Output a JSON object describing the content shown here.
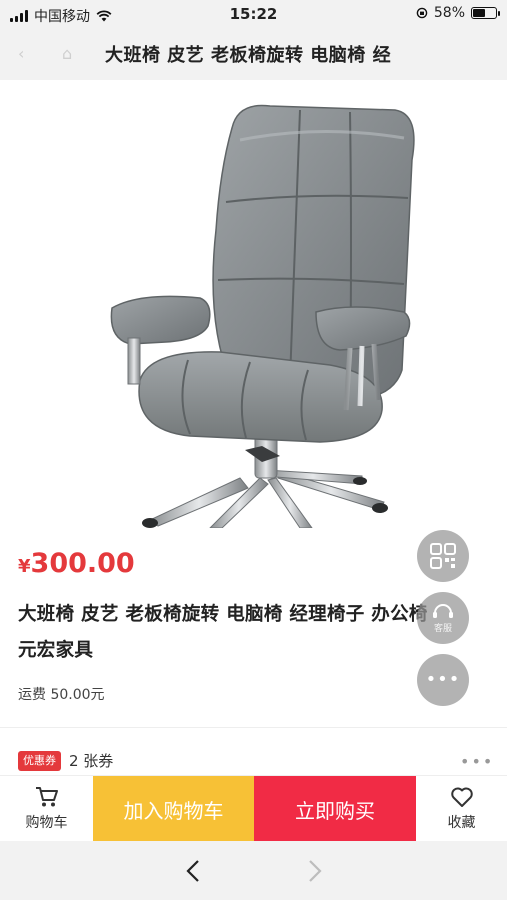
{
  "status_bar": {
    "carrier": "中国移动",
    "time": "15:22",
    "battery_percent": "58%",
    "battery_level": 0.58,
    "icons": [
      "signal-icon",
      "wifi-icon",
      "orientation-lock-icon",
      "battery-icon"
    ]
  },
  "header": {
    "title": "大班椅 皮艺 老板椅旋转 电脑椅 经"
  },
  "product": {
    "price_symbol": "¥",
    "price_value": "300.00",
    "name_line1": "大班椅 皮艺 老板椅旋转 电脑椅 经理椅子 办公椅",
    "name_line2": "元宏家具",
    "shipping": "运费 50.00元",
    "image_icon": "office-chair-image"
  },
  "side_buttons": {
    "qr_icon": "qr-code-icon",
    "service_label": "客服",
    "more_icon": "more-dots-icon"
  },
  "coupon": {
    "tag": "优惠券",
    "count": "2 张券",
    "more": "•••"
  },
  "action_bar": {
    "cart_label": "购物车",
    "add_to_cart_label": "加入购物车",
    "buy_now_label": "立即购买",
    "favorite_label": "收藏"
  },
  "colors": {
    "price": "#e4393c",
    "add_to_cart_bg": "#f7c136",
    "buy_now_bg": "#f12b45",
    "bar_bg": "#f2f2f2"
  }
}
